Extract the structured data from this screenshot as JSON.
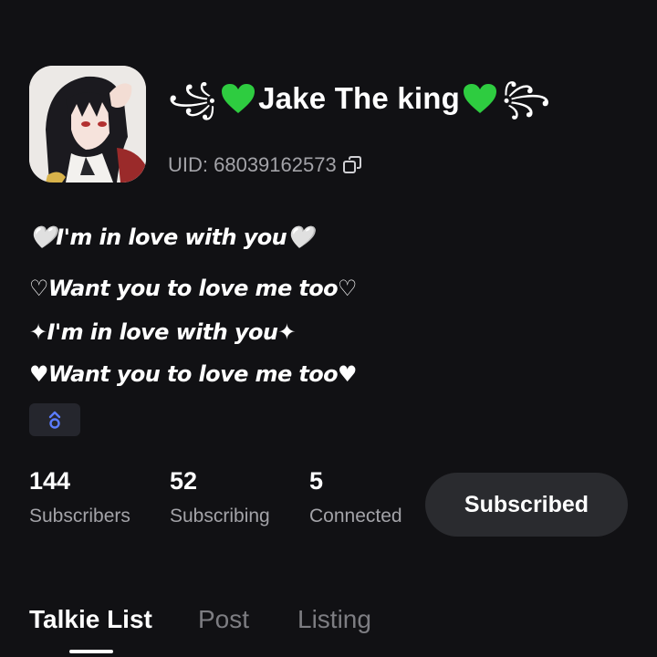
{
  "profile": {
    "display_name": "Jake The king",
    "name_deco_left": "꧁",
    "name_deco_right": "꧂",
    "heart_color": "#2ecc40",
    "uid_text": "UID: 68039162573"
  },
  "bio": {
    "line1": "🤍I'm in love with you🤍",
    "line2": "♡Want you to love me too♡",
    "line3": "✦I'm in love with you✦",
    "line4": "♥Want you to love me too♥"
  },
  "stats": {
    "subscribers_count": "144",
    "subscribers_label": "Subscribers",
    "subscribing_count": "52",
    "subscribing_label": "Subscribing",
    "connected_count": "5",
    "connected_label": "Connected"
  },
  "actions": {
    "subscribed_label": "Subscribed"
  },
  "tabs": [
    {
      "label": "Talkie List",
      "active": true
    },
    {
      "label": "Post",
      "active": false
    },
    {
      "label": "Listing",
      "active": false
    }
  ],
  "colors": {
    "background": "#111114",
    "secondary_text": "#a3a3a8",
    "button_bg": "#2a2b2f",
    "badge_accent": "#5b7cff"
  }
}
